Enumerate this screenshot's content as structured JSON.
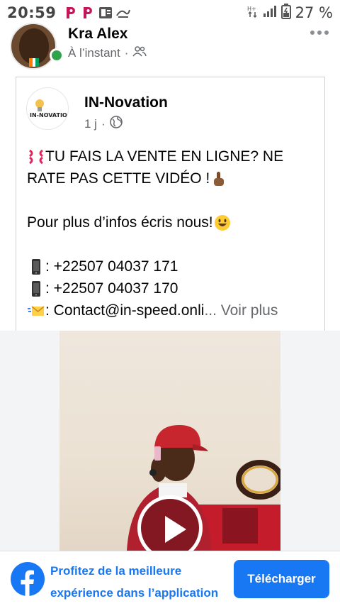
{
  "status_bar": {
    "time": "20:59",
    "battery_pct": "27 %",
    "apps": [
      "picsart-p-icon",
      "picsart-p-icon",
      "powerpoint-icon",
      "signal-app-icon"
    ]
  },
  "author": {
    "name": "Kra Alex",
    "time": "À l’instant",
    "sep": "·",
    "online": true
  },
  "shared_post": {
    "page_name": "IN-Novation",
    "time": "1 j",
    "sep": "·",
    "line1": "TU FAIS LA VENTE EN LIGNE? NE",
    "line2": "RATE PAS CETTE VIDÉO !",
    "line3": "Pour plus d’infos écris nous!",
    "phone1": ": +22507 04037 171",
    "phone2": ": +22507 04037 170",
    "email": ": Contact@in-speed.onli",
    "see_more": "... Voir plus"
  },
  "banner": {
    "text": "Profitez de la meilleure expérience dans l’application",
    "button": "Télécharger"
  },
  "colors": {
    "facebook_blue": "#1877f2",
    "online_green": "#31a24c",
    "meta_gray": "#65676b"
  }
}
